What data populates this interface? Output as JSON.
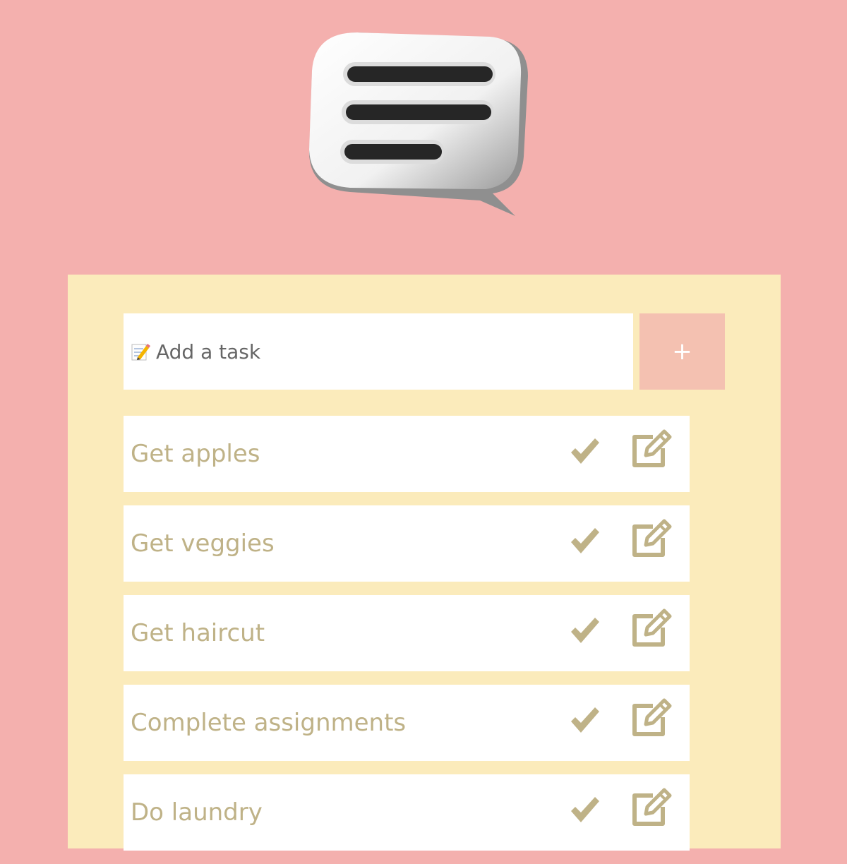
{
  "header": {
    "logo_icon": "chat-bubble-icon"
  },
  "new_task": {
    "placeholder": "Add a task",
    "icon": "memo-pencil-icon",
    "add_label": "+"
  },
  "tasks": [
    {
      "text": "Get apples"
    },
    {
      "text": "Get veggies"
    },
    {
      "text": "Get haircut"
    },
    {
      "text": "Complete assignments"
    },
    {
      "text": "Do laundry"
    }
  ],
  "colors": {
    "background": "#f4b0ae",
    "panel": "#fbebbb",
    "add_button": "#f4c1b1",
    "task_text": "#bfb287"
  }
}
